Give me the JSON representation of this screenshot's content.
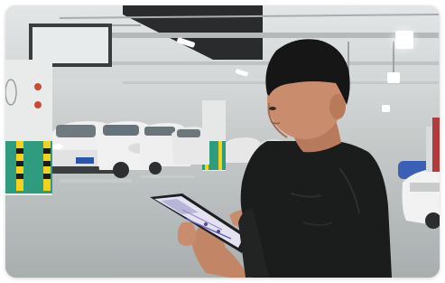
{
  "photo": {
    "alt": "",
    "colors": {
      "ceiling": "#dcdfe0",
      "wall": "#c9cdcc",
      "floor": "#b7bcbd",
      "pillar_stripe": "#2f9c80",
      "shirt": "#1b1c1c",
      "skin": "#c98d6e",
      "hair": "#161616",
      "car_white": "#eeeeee",
      "tablet_screen": "#e6e4f2"
    }
  }
}
